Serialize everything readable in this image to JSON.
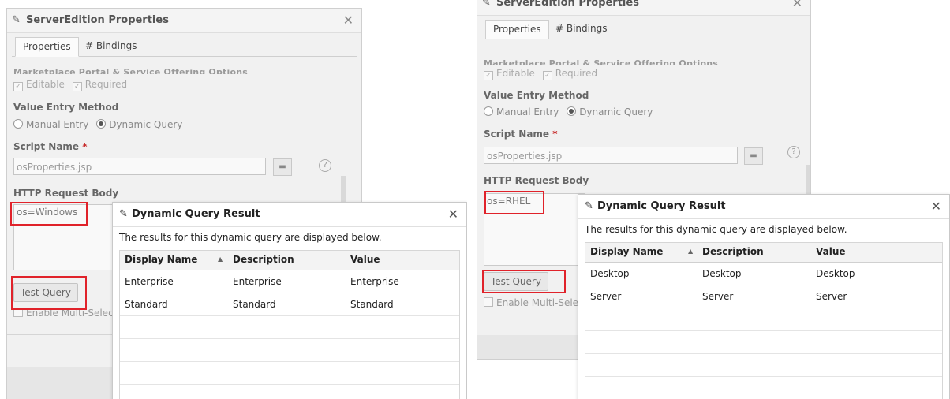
{
  "panels": [
    {
      "props_title": "ServerEdition Properties",
      "tabs": [
        "Properties",
        "# Bindings"
      ],
      "cut_heading": "Marketplace Portal & Service Offering Options",
      "checkboxes": [
        "Editable",
        "Required"
      ],
      "value_entry_label": "Value Entry Method",
      "radio_options": [
        "Manual Entry",
        "Dynamic Query"
      ],
      "selected_radio": "Dynamic Query",
      "script_label": "Script Name",
      "required_mark": "*",
      "script_value": "osProperties.jsp",
      "http_label": "HTTP Request Body",
      "http_value": "os=Windows",
      "test_button": "Test Query",
      "multi_select": "Enable Multi-Selection",
      "dq_title": "Dynamic Query Result",
      "dq_desc": "The results for this dynamic query are displayed below.",
      "columns": [
        "Display Name",
        "Description",
        "Value"
      ],
      "rows": [
        [
          "Enterprise",
          "Enterprise",
          "Enterprise"
        ],
        [
          "Standard",
          "Standard",
          "Standard"
        ]
      ]
    },
    {
      "props_title": "ServerEdition Properties",
      "tabs": [
        "Properties",
        "# Bindings"
      ],
      "cut_heading": "Marketplace Portal & Service Offering Options",
      "checkboxes": [
        "Editable",
        "Required"
      ],
      "value_entry_label": "Value Entry Method",
      "radio_options": [
        "Manual Entry",
        "Dynamic Query"
      ],
      "selected_radio": "Dynamic Query",
      "script_label": "Script Name",
      "required_mark": "*",
      "script_value": "osProperties.jsp",
      "http_label": "HTTP Request Body",
      "http_value": "os=RHEL",
      "test_button": "Test Query",
      "multi_select": "Enable Multi-Selection",
      "dq_title": "Dynamic Query Result",
      "dq_desc": "The results for this dynamic query are displayed below.",
      "columns": [
        "Display Name",
        "Description",
        "Value"
      ],
      "rows": [
        [
          "Desktop",
          "Desktop",
          "Desktop"
        ],
        [
          "Server",
          "Server",
          "Server"
        ]
      ]
    }
  ],
  "colors": {
    "highlight": "#e0222a",
    "required": "#c62828"
  },
  "icons": [
    "edit-icon",
    "close-icon",
    "help-icon",
    "browse-icon",
    "sort-asc-icon",
    "checkbox-checked-icon"
  ]
}
